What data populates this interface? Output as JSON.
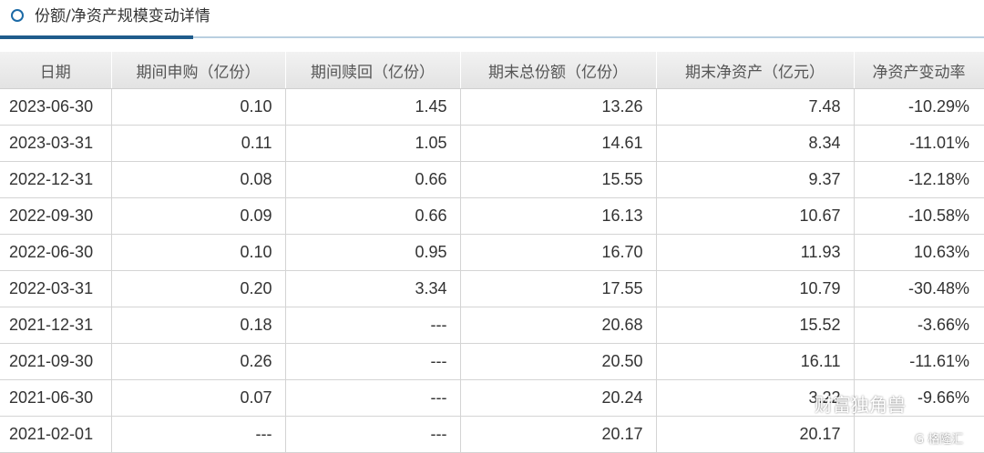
{
  "header": {
    "title": "份额/净资产规模变动详情"
  },
  "table": {
    "columns": [
      "日期",
      "期间申购（亿份）",
      "期间赎回（亿份）",
      "期末总份额（亿份）",
      "期末净资产（亿元）",
      "净资产变动率"
    ],
    "rows": [
      [
        "2023-06-30",
        "0.10",
        "1.45",
        "13.26",
        "7.48",
        "-10.29%"
      ],
      [
        "2023-03-31",
        "0.11",
        "1.05",
        "14.61",
        "8.34",
        "-11.01%"
      ],
      [
        "2022-12-31",
        "0.08",
        "0.66",
        "15.55",
        "9.37",
        "-12.18%"
      ],
      [
        "2022-09-30",
        "0.09",
        "0.66",
        "16.13",
        "10.67",
        "-10.58%"
      ],
      [
        "2022-06-30",
        "0.10",
        "0.95",
        "16.70",
        "11.93",
        "10.63%"
      ],
      [
        "2022-03-31",
        "0.20",
        "3.34",
        "17.55",
        "10.79",
        "-30.48%"
      ],
      [
        "2021-12-31",
        "0.18",
        "---",
        "20.68",
        "15.52",
        "-3.66%"
      ],
      [
        "2021-09-30",
        "0.26",
        "---",
        "20.50",
        "16.11",
        "-11.61%"
      ],
      [
        "2021-06-30",
        "0.07",
        "---",
        "20.24",
        "3.22",
        "-9.66%"
      ],
      [
        "2021-02-01",
        "---",
        "---",
        "20.17",
        "20.17",
        ""
      ]
    ]
  },
  "watermark": {
    "text": "财富独角兽",
    "sub": "G 格隆汇"
  },
  "colors": {
    "accent": "#1f5c8c",
    "header_bg": "#e8e8e8",
    "border": "#d4d4d4"
  }
}
